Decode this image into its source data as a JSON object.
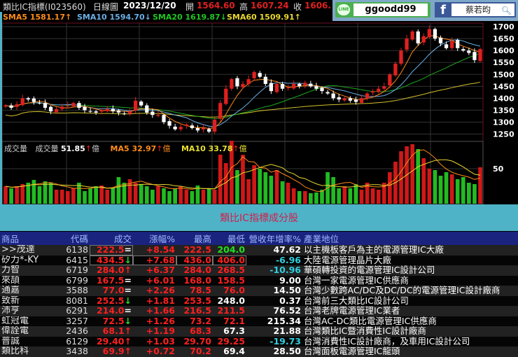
{
  "header": {
    "title": "類比IC指標(I023560)",
    "period": "日線圖",
    "date": "2023/12/20",
    "open_label": "開",
    "open": "1564.60",
    "high_label": "高",
    "high": "1607.24",
    "close_label": "收",
    "close": "1606."
  },
  "social": {
    "line_icon": "LINE",
    "line_id": "ggoodd99",
    "fb_icon": "f",
    "fb_name": "蔡若昀"
  },
  "legend": {
    "sma5": "SMA5 1581.17↑",
    "sma10": "SMA10 1594.70↓",
    "sma20": "SMA20 1619.87↓",
    "sma60": "SMA60 1509.91↑"
  },
  "volume_legend": {
    "title": "成交量",
    "vol": "成交量",
    "vol_value": "51.85",
    "ma5": "MA5 32.97",
    "ma10": "MA10 33.78",
    "unit": "億",
    "up": "↑"
  },
  "colors": {
    "sma5": "#ff8c1a",
    "sma10": "#6ab0e8",
    "sma20": "#1fa81f",
    "sma60": "#d4c22a",
    "up": "#e02020",
    "down": "#ffffff",
    "vol_up": "#d01818",
    "vol_down": "#22bb22"
  },
  "chart_data": {
    "type": "candlestick",
    "title": "類比IC指標 日線圖",
    "price_axis": {
      "ticks": [
        1250,
        1300,
        1350,
        1400,
        1450,
        1500,
        1550,
        1600,
        1650,
        1700
      ],
      "ylim": [
        1225,
        1715
      ]
    },
    "volume_axis": {
      "ticks": [
        50
      ],
      "ylim": [
        0,
        88
      ]
    },
    "closes": [
      1370,
      1360,
      1375,
      1400,
      1395,
      1385,
      1380,
      1360,
      1345,
      1355,
      1365,
      1370,
      1380,
      1360,
      1350,
      1345,
      1340,
      1350,
      1355,
      1345,
      1340,
      1335,
      1345,
      1390,
      1370,
      1340,
      1330,
      1330,
      1300,
      1285,
      1270,
      1280,
      1290,
      1275,
      1265,
      1275,
      1260,
      1310,
      1380,
      1440,
      1480,
      1450,
      1460,
      1480,
      1510,
      1490,
      1460,
      1430,
      1460,
      1440,
      1445,
      1460,
      1450,
      1465,
      1450,
      1440,
      1430,
      1420,
      1400,
      1395,
      1400,
      1390,
      1385,
      1400,
      1420,
      1430,
      1440,
      1450,
      1500,
      1545,
      1600,
      1650,
      1680,
      1630,
      1660,
      1690,
      1650,
      1630,
      1610,
      1640,
      1610,
      1600,
      1590,
      1560,
      1606
    ],
    "volumes": [
      25,
      22,
      25,
      28,
      30,
      34,
      25,
      32,
      30,
      20,
      20,
      18,
      22,
      30,
      18,
      22,
      25,
      26,
      20,
      22,
      38,
      30,
      35,
      30,
      28,
      25,
      20,
      25,
      22,
      18,
      22,
      25,
      20,
      18,
      26,
      20,
      22,
      20,
      70,
      58,
      90,
      48,
      70,
      35,
      55,
      50,
      45,
      40,
      48,
      32,
      30,
      22,
      18,
      18,
      15,
      16,
      20,
      45,
      38,
      22,
      25,
      22,
      28,
      20,
      30,
      22,
      20,
      30,
      45,
      60,
      75,
      82,
      85,
      78,
      65,
      50,
      48,
      40,
      45,
      42,
      35,
      38,
      30,
      28,
      52
    ]
  },
  "section_title": "類比IC指標成分股",
  "table": {
    "headers": [
      "商品",
      "代碼",
      "成交",
      "漲幅%",
      "最高",
      "最低",
      "營收年增率%",
      "產業地位"
    ],
    "rows": [
      {
        "name": ">>茂達",
        "code": "6138",
        "price": "222.5",
        "mark": "=",
        "chg": "+8.54",
        "high": "222.5",
        "low": "204.0",
        "lowc": "g",
        "rev": "47.62",
        "revc": "w",
        "desc": "以主機板客戶為主的電源管理IC大廠"
      },
      {
        "name": "矽力*-KY",
        "code": "6415",
        "price": "434.5",
        "mark": "↓",
        "chg": "+7.68",
        "high": "436.0",
        "low": "406.0",
        "lowc": "r",
        "rev": "-6.96",
        "revc": "c",
        "desc": "大陸電源管理晶片大廠"
      },
      {
        "name": "力智",
        "code": "6719",
        "price": "284.0",
        "mark": "↑",
        "chg": "+6.37",
        "high": "284.0",
        "low": "268.5",
        "lowc": "r",
        "rev": "-10.96",
        "revc": "c",
        "desc": "華碩轉投資的電源管理IC設計公司"
      },
      {
        "name": "來頡",
        "code": "6799",
        "price": "167.5",
        "mark": "=",
        "chg": "+6.01",
        "high": "168.0",
        "low": "158.5",
        "lowc": "r",
        "rev": "9.00",
        "revc": "w",
        "desc": "台灣一家電源管理IC供應商"
      },
      {
        "name": "通嘉",
        "code": "3588",
        "price": "77.0",
        "mark": "=",
        "chg": "+2.26",
        "high": "78.5",
        "low": "76.0",
        "lowc": "r",
        "rev": "14.50",
        "revc": "w",
        "desc": "台灣少數跨AC/DC及DC/DC的電源管理IC設計廠商"
      },
      {
        "name": "致新",
        "code": "8081",
        "price": "252.5",
        "mark": "↓",
        "chg": "+1.81",
        "high": "253.5",
        "low": "248.0",
        "lowc": "w",
        "rev": "0.37",
        "revc": "w",
        "desc": "台灣前三大類比IC設計公司"
      },
      {
        "name": "沛亨",
        "code": "6291",
        "price": "214.0",
        "mark": "=",
        "chg": "+1.66",
        "high": "216.5",
        "low": "211.5",
        "lowc": "r",
        "rev": "76.52",
        "revc": "w",
        "desc": "台灣老牌電源管理IC業者"
      },
      {
        "name": "虹冠電",
        "code": "3257",
        "price": "72.5",
        "mark": "↓",
        "chg": "+1.26",
        "high": "73.2",
        "low": "72.1",
        "lowc": "r",
        "rev": "215.34",
        "revc": "w",
        "desc": "台灣AC-DC類比電源管理IC供應商"
      },
      {
        "name": "偉詮電",
        "code": "2436",
        "price": "68.1",
        "mark": "↑",
        "chg": "+1.19",
        "high": "68.3",
        "low": "67.3",
        "lowc": "w",
        "rev": "21.88",
        "revc": "w",
        "desc": "台灣類比IC暨消費性IC設計廠商"
      },
      {
        "name": "普誠",
        "code": "6129",
        "price": "29.40",
        "mark": "↑",
        "chg": "+1.03",
        "high": "29.70",
        "low": "29.25",
        "lowc": "r",
        "rev": "-19.73",
        "revc": "c",
        "desc": "台灣消費性IC設計廠商，及車用IC設計公司"
      },
      {
        "name": "類比科",
        "code": "3438",
        "price": "69.9",
        "mark": "↑",
        "chg": "+0.72",
        "high": "70.2",
        "low": "69.4",
        "lowc": "w",
        "rev": "28.50",
        "revc": "w",
        "desc": "台灣面板電源管理IC龍頭"
      }
    ]
  }
}
